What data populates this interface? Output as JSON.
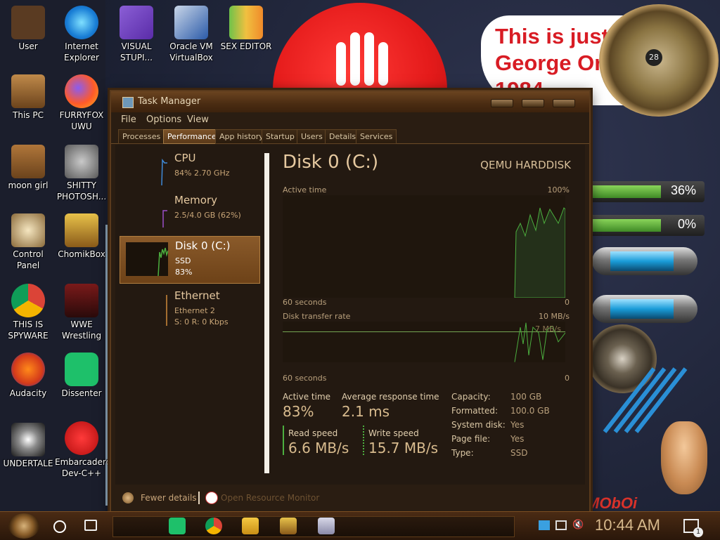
{
  "desktop": {
    "icons": [
      {
        "label": "User",
        "id": "user"
      },
      {
        "label": "Internet Explorer",
        "id": "ie"
      },
      {
        "label": "VISUAL STUPI...",
        "id": "vs"
      },
      {
        "label": "Oracle VM VirtualBox",
        "id": "vbox"
      },
      {
        "label": "SEX EDITOR",
        "id": "hxd"
      },
      {
        "label": "This PC",
        "id": "thispc"
      },
      {
        "label": "FURRYFOX UWU",
        "id": "firefox"
      },
      {
        "label": "moon girl",
        "id": "moongirl"
      },
      {
        "label": "SHITTY PHOTOSH...",
        "id": "gimp"
      },
      {
        "label": "Control Panel",
        "id": "controlpanel"
      },
      {
        "label": "ChomikBox",
        "id": "chomikbox"
      },
      {
        "label": "THIS IS SPYWARE",
        "id": "chrome"
      },
      {
        "label": "WWE Wrestling",
        "id": "wwe"
      },
      {
        "label": "Audacity",
        "id": "audacity"
      },
      {
        "label": "Dissenter",
        "id": "dissenter"
      },
      {
        "label": "UNDERTALE",
        "id": "undertale"
      },
      {
        "label": "Embarcadero Dev-C++",
        "id": "devcpp"
      }
    ],
    "wallpaper_text": [
      "This is just",
      "George Orwell",
      "1984"
    ],
    "clock_day": "28",
    "gauges": [
      "36%",
      "0%"
    ],
    "corner_text": "MObOi"
  },
  "task_manager": {
    "title": "Task Manager",
    "menu": [
      "File",
      "Options",
      "View"
    ],
    "tabs": [
      "Processes",
      "Performance",
      "App history",
      "Startup",
      "Users",
      "Details",
      "Services"
    ],
    "active_tab": "Performance",
    "sidebar": [
      {
        "name": "CPU",
        "line2": "84%  2.70 GHz",
        "line3": "",
        "color": "#3f8ad8"
      },
      {
        "name": "Memory",
        "line2": "2.5/4.0 GB (62%)",
        "line3": "",
        "color": "#9b4fc9"
      },
      {
        "name": "Disk 0 (C:)",
        "line2": "SSD",
        "line3": "83%",
        "color": "#4caf3f",
        "selected": true
      },
      {
        "name": "Ethernet",
        "line2": "Ethernet 2",
        "line3": "S: 0  R: 0 Kbps",
        "color": "#d08a3a"
      }
    ],
    "detail": {
      "title": "Disk 0 (C:)",
      "model": "QEMU HARDDISK",
      "chart1": {
        "label": "Active time",
        "max": "100%",
        "x_left": "60 seconds",
        "x_right": "0"
      },
      "chart2": {
        "label": "Disk transfer rate",
        "max": "10 MB/s",
        "mid": "7 MB/s",
        "x_left": "60 seconds",
        "x_right": "0"
      },
      "stats": {
        "active_time_label": "Active time",
        "active_time_value": "83%",
        "avg_resp_label": "Average response time",
        "avg_resp_value": "2.1 ms",
        "read_label": "Read speed",
        "read_value": "6.6 MB/s",
        "write_label": "Write speed",
        "write_value": "15.7 MB/s"
      },
      "properties": [
        {
          "key": "Capacity:",
          "value": "100 GB"
        },
        {
          "key": "Formatted:",
          "value": "100.0 GB"
        },
        {
          "key": "System disk:",
          "value": "Yes"
        },
        {
          "key": "Page file:",
          "value": "Yes"
        },
        {
          "key": "Type:",
          "value": "SSD"
        }
      ]
    },
    "footer": {
      "fewer_details": "Fewer details",
      "open_resource_monitor": "Open Resource Monitor"
    }
  },
  "taskbar": {
    "time": "10:44 AM",
    "notification_count": "1",
    "pinned": [
      "dissenter",
      "chrome",
      "file-explorer",
      "chomikbox",
      "photos"
    ]
  },
  "colors": {
    "accent": "#7a5128",
    "graph_line": "#4caf3f",
    "background": "#2a1d12"
  }
}
